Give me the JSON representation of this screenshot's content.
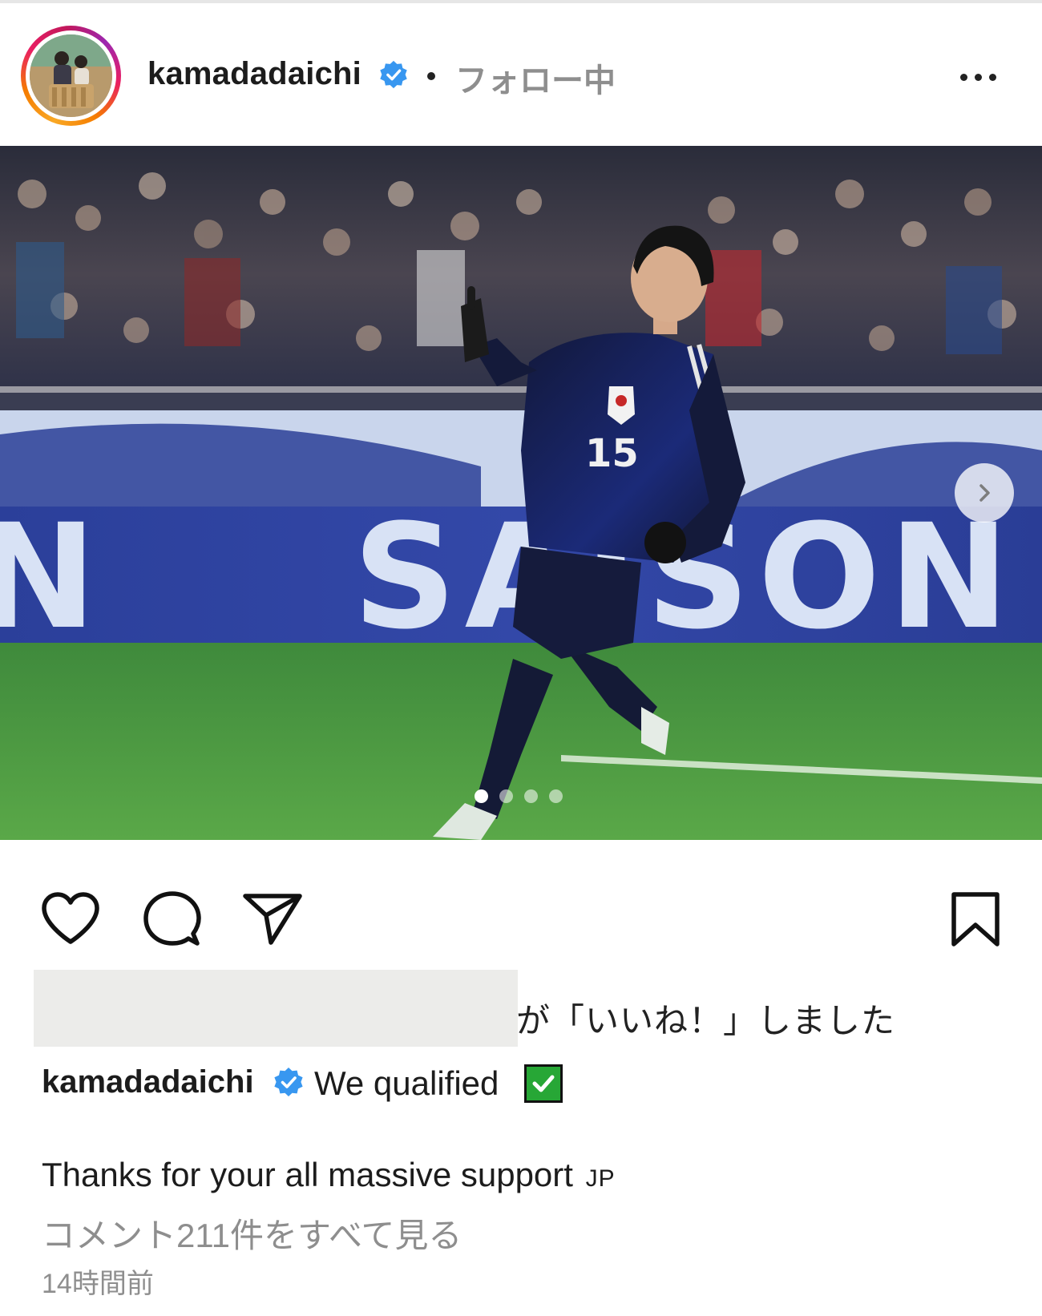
{
  "post": {
    "username": "kamadadaichi",
    "follow_status": "フォロー中",
    "separator": "•",
    "verified": true,
    "accent_verified": "#3897f0"
  },
  "carousel": {
    "slide_count": 4,
    "active_index": 0,
    "next_icon": "chevron-right-icon",
    "banner_text": "SAISON",
    "jersey_number": "15"
  },
  "actions": {
    "icons": [
      "heart-icon",
      "comment-icon",
      "share-icon",
      "bookmark-icon"
    ]
  },
  "likes": {
    "text": "が「いいね！」しました"
  },
  "caption": {
    "username": "kamadadaichi",
    "text": "We qualified",
    "emoji": "check-box-icon",
    "line2": "Thanks for your all massive support",
    "line2_flag": "JP"
  },
  "comments_link": "コメント211件をすべて見る",
  "timestamp": "14時間前"
}
